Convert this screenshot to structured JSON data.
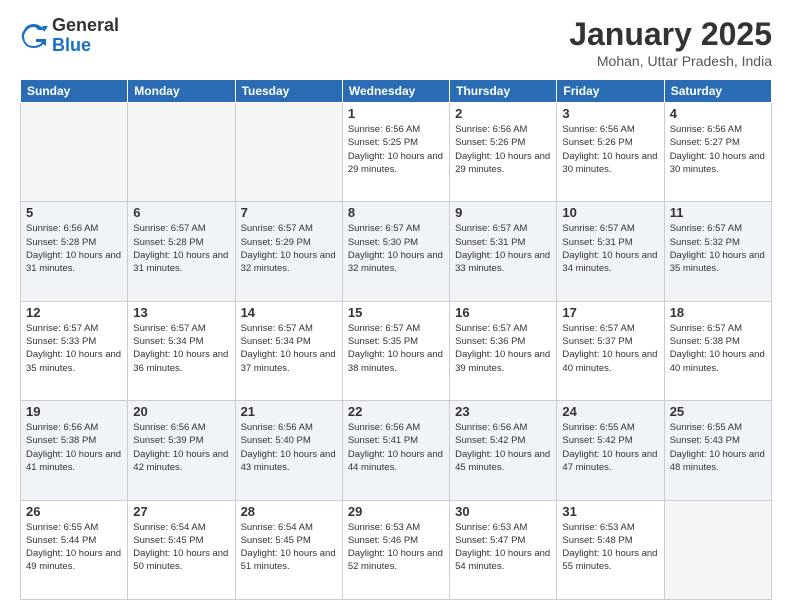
{
  "logo": {
    "general": "General",
    "blue": "Blue"
  },
  "header": {
    "month": "January 2025",
    "location": "Mohan, Uttar Pradesh, India"
  },
  "weekdays": [
    "Sunday",
    "Monday",
    "Tuesday",
    "Wednesday",
    "Thursday",
    "Friday",
    "Saturday"
  ],
  "weeks": [
    [
      {
        "day": "",
        "info": ""
      },
      {
        "day": "",
        "info": ""
      },
      {
        "day": "",
        "info": ""
      },
      {
        "day": "1",
        "info": "Sunrise: 6:56 AM\nSunset: 5:25 PM\nDaylight: 10 hours\nand 29 minutes."
      },
      {
        "day": "2",
        "info": "Sunrise: 6:56 AM\nSunset: 5:26 PM\nDaylight: 10 hours\nand 29 minutes."
      },
      {
        "day": "3",
        "info": "Sunrise: 6:56 AM\nSunset: 5:26 PM\nDaylight: 10 hours\nand 30 minutes."
      },
      {
        "day": "4",
        "info": "Sunrise: 6:56 AM\nSunset: 5:27 PM\nDaylight: 10 hours\nand 30 minutes."
      }
    ],
    [
      {
        "day": "5",
        "info": "Sunrise: 6:56 AM\nSunset: 5:28 PM\nDaylight: 10 hours\nand 31 minutes."
      },
      {
        "day": "6",
        "info": "Sunrise: 6:57 AM\nSunset: 5:28 PM\nDaylight: 10 hours\nand 31 minutes."
      },
      {
        "day": "7",
        "info": "Sunrise: 6:57 AM\nSunset: 5:29 PM\nDaylight: 10 hours\nand 32 minutes."
      },
      {
        "day": "8",
        "info": "Sunrise: 6:57 AM\nSunset: 5:30 PM\nDaylight: 10 hours\nand 32 minutes."
      },
      {
        "day": "9",
        "info": "Sunrise: 6:57 AM\nSunset: 5:31 PM\nDaylight: 10 hours\nand 33 minutes."
      },
      {
        "day": "10",
        "info": "Sunrise: 6:57 AM\nSunset: 5:31 PM\nDaylight: 10 hours\nand 34 minutes."
      },
      {
        "day": "11",
        "info": "Sunrise: 6:57 AM\nSunset: 5:32 PM\nDaylight: 10 hours\nand 35 minutes."
      }
    ],
    [
      {
        "day": "12",
        "info": "Sunrise: 6:57 AM\nSunset: 5:33 PM\nDaylight: 10 hours\nand 35 minutes."
      },
      {
        "day": "13",
        "info": "Sunrise: 6:57 AM\nSunset: 5:34 PM\nDaylight: 10 hours\nand 36 minutes."
      },
      {
        "day": "14",
        "info": "Sunrise: 6:57 AM\nSunset: 5:34 PM\nDaylight: 10 hours\nand 37 minutes."
      },
      {
        "day": "15",
        "info": "Sunrise: 6:57 AM\nSunset: 5:35 PM\nDaylight: 10 hours\nand 38 minutes."
      },
      {
        "day": "16",
        "info": "Sunrise: 6:57 AM\nSunset: 5:36 PM\nDaylight: 10 hours\nand 39 minutes."
      },
      {
        "day": "17",
        "info": "Sunrise: 6:57 AM\nSunset: 5:37 PM\nDaylight: 10 hours\nand 40 minutes."
      },
      {
        "day": "18",
        "info": "Sunrise: 6:57 AM\nSunset: 5:38 PM\nDaylight: 10 hours\nand 40 minutes."
      }
    ],
    [
      {
        "day": "19",
        "info": "Sunrise: 6:56 AM\nSunset: 5:38 PM\nDaylight: 10 hours\nand 41 minutes."
      },
      {
        "day": "20",
        "info": "Sunrise: 6:56 AM\nSunset: 5:39 PM\nDaylight: 10 hours\nand 42 minutes."
      },
      {
        "day": "21",
        "info": "Sunrise: 6:56 AM\nSunset: 5:40 PM\nDaylight: 10 hours\nand 43 minutes."
      },
      {
        "day": "22",
        "info": "Sunrise: 6:56 AM\nSunset: 5:41 PM\nDaylight: 10 hours\nand 44 minutes."
      },
      {
        "day": "23",
        "info": "Sunrise: 6:56 AM\nSunset: 5:42 PM\nDaylight: 10 hours\nand 45 minutes."
      },
      {
        "day": "24",
        "info": "Sunrise: 6:55 AM\nSunset: 5:42 PM\nDaylight: 10 hours\nand 47 minutes."
      },
      {
        "day": "25",
        "info": "Sunrise: 6:55 AM\nSunset: 5:43 PM\nDaylight: 10 hours\nand 48 minutes."
      }
    ],
    [
      {
        "day": "26",
        "info": "Sunrise: 6:55 AM\nSunset: 5:44 PM\nDaylight: 10 hours\nand 49 minutes."
      },
      {
        "day": "27",
        "info": "Sunrise: 6:54 AM\nSunset: 5:45 PM\nDaylight: 10 hours\nand 50 minutes."
      },
      {
        "day": "28",
        "info": "Sunrise: 6:54 AM\nSunset: 5:45 PM\nDaylight: 10 hours\nand 51 minutes."
      },
      {
        "day": "29",
        "info": "Sunrise: 6:53 AM\nSunset: 5:46 PM\nDaylight: 10 hours\nand 52 minutes."
      },
      {
        "day": "30",
        "info": "Sunrise: 6:53 AM\nSunset: 5:47 PM\nDaylight: 10 hours\nand 54 minutes."
      },
      {
        "day": "31",
        "info": "Sunrise: 6:53 AM\nSunset: 5:48 PM\nDaylight: 10 hours\nand 55 minutes."
      },
      {
        "day": "",
        "info": ""
      }
    ]
  ]
}
